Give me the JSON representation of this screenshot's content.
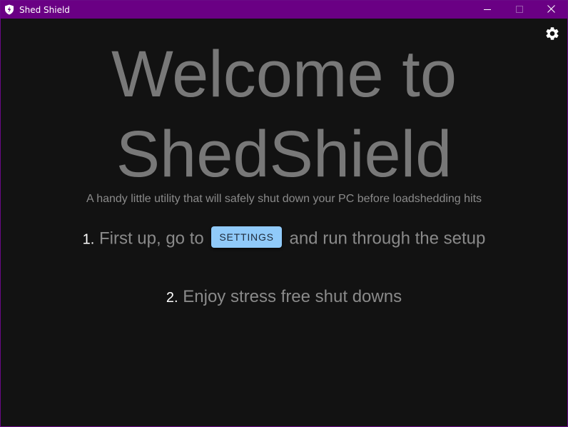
{
  "window": {
    "title": "Shed Shield",
    "app_icon": "shield-logo-icon",
    "controls": [
      "minimize-icon",
      "maximize-icon",
      "close-icon"
    ]
  },
  "toolbar": {
    "settings_icon": "gear-icon"
  },
  "hero": {
    "line1": "Welcome to",
    "line2": "ShedShield"
  },
  "subtitle": "A handy little utility that will safely shut down your PC before loadshedding hits",
  "steps": [
    {
      "number": "1.",
      "before": "First up, go to",
      "button_label": "SETTINGS",
      "after": "and run through the setup"
    },
    {
      "number": "2.",
      "text": "Enjoy stress free shut downs"
    }
  ],
  "colors": {
    "titlebar": "#6a0084",
    "background": "#121212",
    "hero_text": "#787878",
    "button": "#90caf9"
  }
}
